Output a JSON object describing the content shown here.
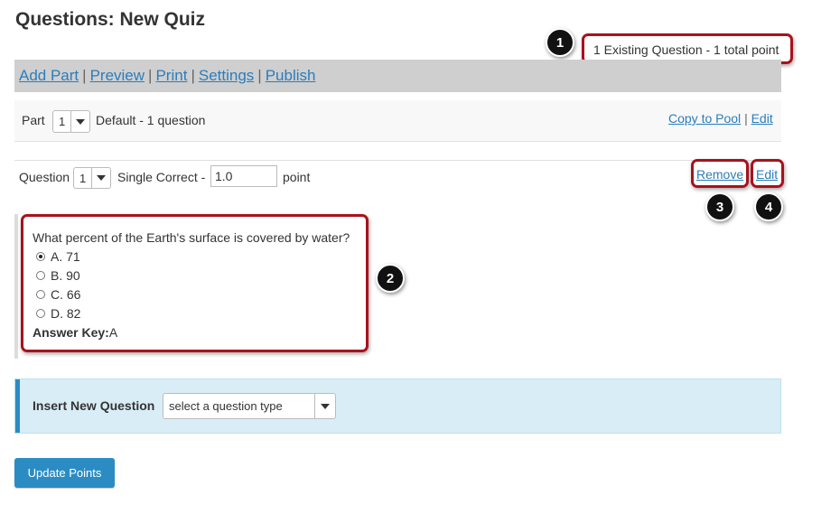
{
  "page": {
    "title": "Questions: New Quiz",
    "summary": "1 Existing Question - 1 total point"
  },
  "toolbar": {
    "add_part": "Add Part",
    "preview": "Preview",
    "print": "Print",
    "settings": "Settings",
    "publish": "Publish",
    "separator": "|"
  },
  "part": {
    "label": "Part",
    "selected": "1",
    "description": "Default - 1 question",
    "copy_to_pool": "Copy to Pool",
    "edit": "Edit",
    "separator": "|"
  },
  "question": {
    "label": "Question",
    "selected": "1",
    "type": "Single Correct -",
    "points_value": "1.0",
    "points_unit": "point",
    "remove": "Remove",
    "edit": "Edit",
    "text": "What percent of the Earth's surface is covered by water?",
    "options": [
      {
        "label": "A. 71",
        "selected": true
      },
      {
        "label": "B. 90",
        "selected": false
      },
      {
        "label": "C. 66",
        "selected": false
      },
      {
        "label": "D. 82",
        "selected": false
      }
    ],
    "answer_key_label": "Answer Key:",
    "answer_key_value": "A"
  },
  "insert": {
    "label": "Insert New Question",
    "select_placeholder": "select a question type"
  },
  "update_button": "Update Points",
  "callouts": [
    "1",
    "2",
    "3",
    "4"
  ],
  "colors": {
    "highlight": "#a8121c",
    "link": "#2b7dbc",
    "primary_button": "#2b8cc4",
    "insert_panel_bg": "#d9edf7",
    "toolbar_bg": "#cfcfcf"
  }
}
